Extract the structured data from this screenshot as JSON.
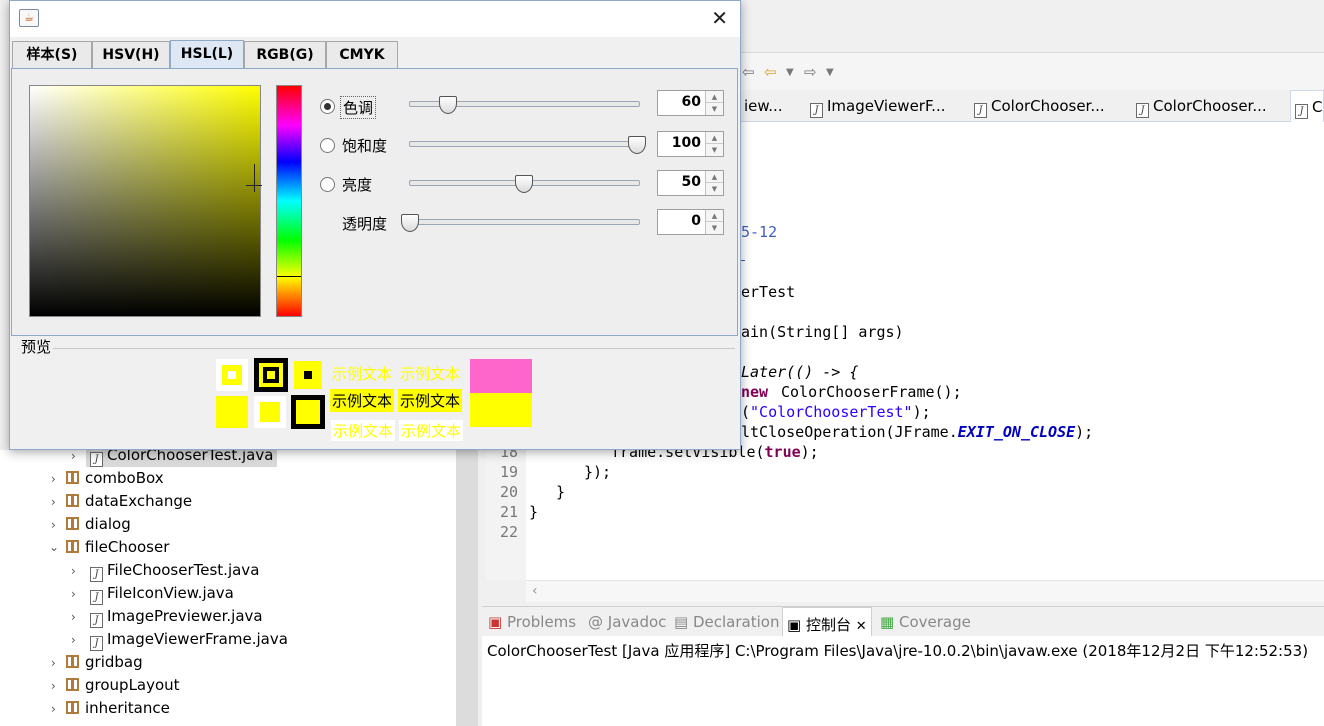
{
  "ide": {
    "editor_tabs": [
      "iew...",
      "ImageViewerF...",
      "ColorChooser...",
      "ColorChooser...",
      "C"
    ],
    "code_lines": [
      {
        "n": "18",
        "text": "frame.setVisible(true);"
      },
      {
        "n": "19",
        "text": "});"
      },
      {
        "n": "20",
        "text": "}"
      },
      {
        "n": "21",
        "text": "}"
      },
      {
        "n": "22",
        "text": ""
      }
    ],
    "code_frag": {
      "date": "5-12",
      "class": "erTest",
      "main": "ain(String[] args)",
      "later": "Later(() -> {",
      "new_frame": "new ColorChooserFrame();",
      "title_str": "\"ColorChooserTest\"",
      "close_op": "ltCloseOperation(JFrame.",
      "exit_const": "EXIT_ON_CLOSE",
      "close_end": ");"
    },
    "bottom_tabs": [
      "Problems",
      "Javadoc",
      "Declaration",
      "控制台",
      "Coverage"
    ],
    "console_text": "ColorChooserTest [Java 应用程序] C:\\Program Files\\Java\\jre-10.0.2\\bin\\javaw.exe  (2018年12月2日 下午12:52:53)",
    "tree": [
      {
        "label": "ColorChooserTest.java",
        "type": "java",
        "indent": 2,
        "selected": true
      },
      {
        "label": "comboBox",
        "type": "pkg",
        "indent": 1
      },
      {
        "label": "dataExchange",
        "type": "pkg",
        "indent": 1
      },
      {
        "label": "dialog",
        "type": "pkg",
        "indent": 1
      },
      {
        "label": "fileChooser",
        "type": "pkg",
        "indent": 1,
        "expanded": true
      },
      {
        "label": "FileChooserTest.java",
        "type": "java",
        "indent": 2
      },
      {
        "label": "FileIconView.java",
        "type": "java",
        "indent": 2
      },
      {
        "label": "ImagePreviewer.java",
        "type": "java",
        "indent": 2
      },
      {
        "label": "ImageViewerFrame.java",
        "type": "java",
        "indent": 2
      },
      {
        "label": "gridbag",
        "type": "pkg",
        "indent": 1
      },
      {
        "label": "groupLayout",
        "type": "pkg",
        "indent": 1
      },
      {
        "label": "inheritance",
        "type": "pkg",
        "indent": 1
      }
    ]
  },
  "dialog": {
    "tabs": [
      "样本(S)",
      "HSV(H)",
      "HSL(L)",
      "RGB(G)",
      "CMYK"
    ],
    "active_tab": 2,
    "controls": [
      {
        "label": "色调",
        "value": "60",
        "selected": true,
        "level": 0.167
      },
      {
        "label": "饱和度",
        "value": "100",
        "selected": false,
        "level": 1.0
      },
      {
        "label": "亮度",
        "value": "50",
        "selected": false,
        "level": 0.5
      },
      {
        "label": "透明度",
        "value": "0",
        "selected": false,
        "level": 0.0
      }
    ],
    "preview_label": "预览",
    "sample_text": "示例文本",
    "colors": {
      "selected": "#ffff00",
      "preview_top": "#ff66cc"
    }
  }
}
